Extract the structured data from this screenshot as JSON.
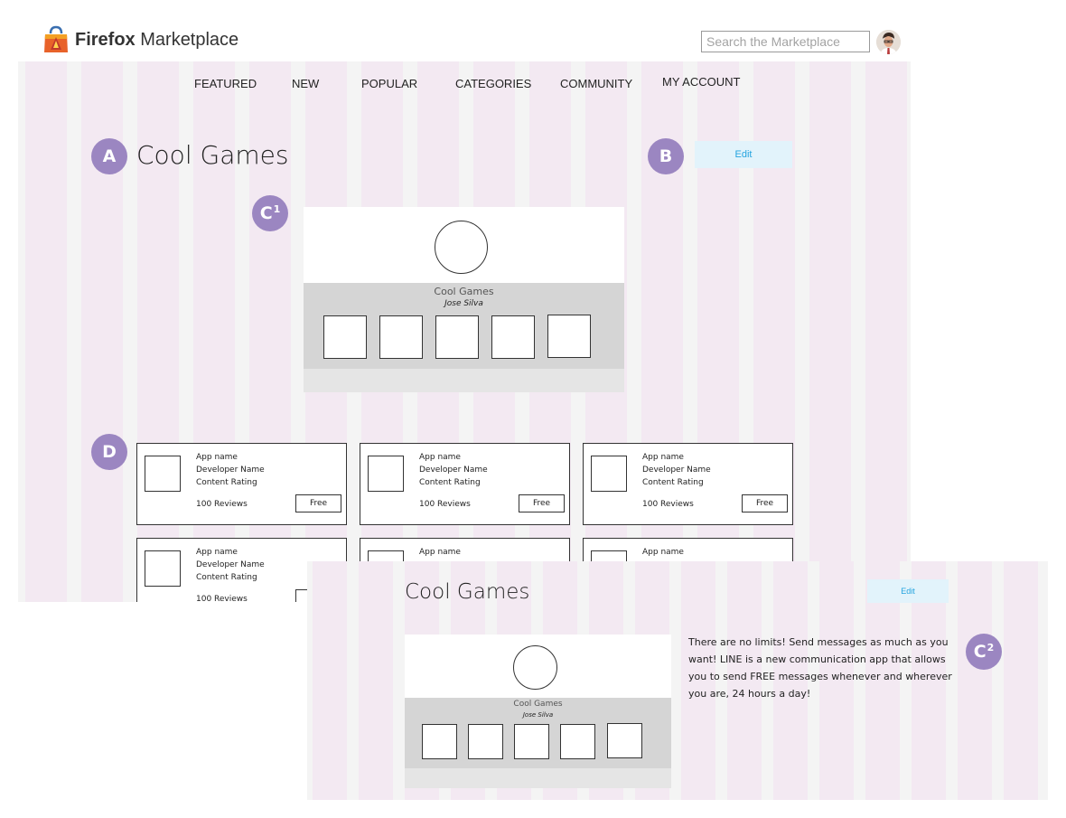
{
  "header": {
    "brand_bold": "Firefox",
    "brand_light": " Marketplace",
    "search_placeholder": "Search the Marketplace"
  },
  "nav": [
    "FEATURED",
    "NEW",
    "POPULAR",
    "CATEGORIES",
    "COMMUNITY",
    "MY ACCOUNT"
  ],
  "markers": {
    "a": "A",
    "b": "B",
    "c1": "C",
    "c1_sup": "1",
    "d": "D",
    "c2": "C",
    "c2_sup": "2"
  },
  "collection": {
    "title": "Cool Games",
    "author": "Jose Silva",
    "edit_label": "Edit"
  },
  "app_tile": {
    "name": "App name",
    "developer": "Developer Name",
    "rating": "Content Rating",
    "reviews": "100 Reviews",
    "price": "Free"
  },
  "description": "There are no limits! Send messages as much as you want! LINE is a new communication app that allows you to send FREE messages whenever and wherever you are, 24 hours a day!",
  "colors": {
    "grid_column": "#f3e9f2",
    "grid_gutter": "#f4f4f4",
    "marker": "#9b86c1",
    "edit_bg": "#e2f3fb",
    "edit_text": "#24a4df"
  }
}
